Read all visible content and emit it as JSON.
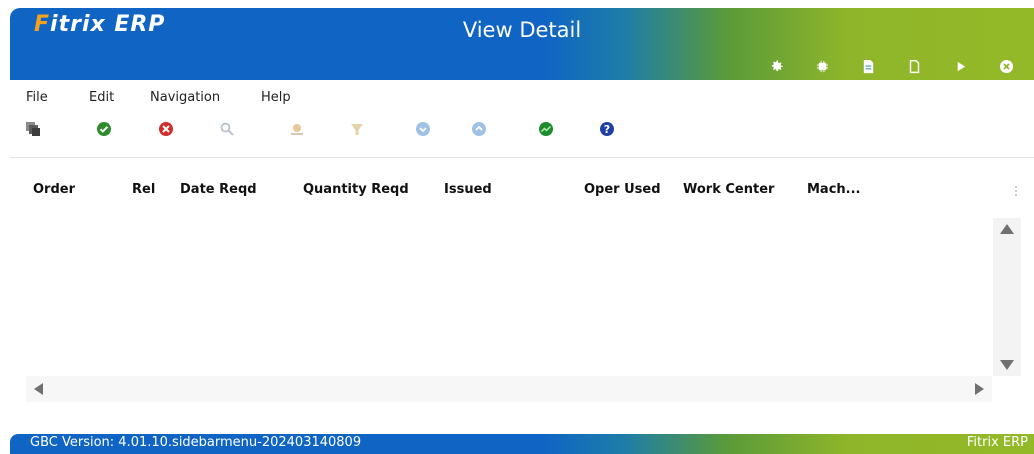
{
  "window": {
    "logo_text": "Fitrix ERP",
    "title": "View Detail",
    "titlebar_icons": [
      {
        "name": "gear-icon",
        "interactable": true
      },
      {
        "name": "chip-icon",
        "interactable": true
      },
      {
        "name": "document-filled-icon",
        "interactable": true
      },
      {
        "name": "document-icon",
        "interactable": true
      },
      {
        "name": "play-icon",
        "interactable": true
      },
      {
        "name": "close-circle-icon",
        "interactable": true
      }
    ]
  },
  "menu": {
    "items": [
      "File",
      "Edit",
      "Navigation",
      "Help"
    ]
  },
  "toolbar": {
    "icons": [
      {
        "name": "copy-windows-icon",
        "state": "enabled"
      },
      {
        "name": "accept-check-icon",
        "state": "enabled"
      },
      {
        "name": "cancel-x-icon",
        "state": "enabled"
      },
      {
        "name": "search-magnifier-icon",
        "state": "disabled"
      },
      {
        "name": "sun-zoom-icon",
        "state": "disabled"
      },
      {
        "name": "funnel-icon",
        "state": "disabled"
      },
      {
        "name": "arrow-down-circle-icon",
        "state": "disabled"
      },
      {
        "name": "arrow-up-circle-icon",
        "state": "disabled"
      },
      {
        "name": "chart-green-icon",
        "state": "enabled"
      },
      {
        "name": "help-question-icon",
        "state": "enabled"
      }
    ]
  },
  "grid": {
    "columns": [
      "Order",
      "Rel",
      "Date Reqd",
      "Quantity Reqd",
      "Issued",
      "Oper Used",
      "Work Center",
      "Mach..."
    ],
    "rows": []
  },
  "footer": {
    "version_text": "GBC Version: 4.01.10.sidebarmenu-202403140809",
    "brand_text": "Fitrix ERP"
  },
  "colors": {
    "titlebar_blue": "#0f64c4",
    "titlebar_green": "#94b928",
    "logo_accent": "#f5a21b"
  }
}
